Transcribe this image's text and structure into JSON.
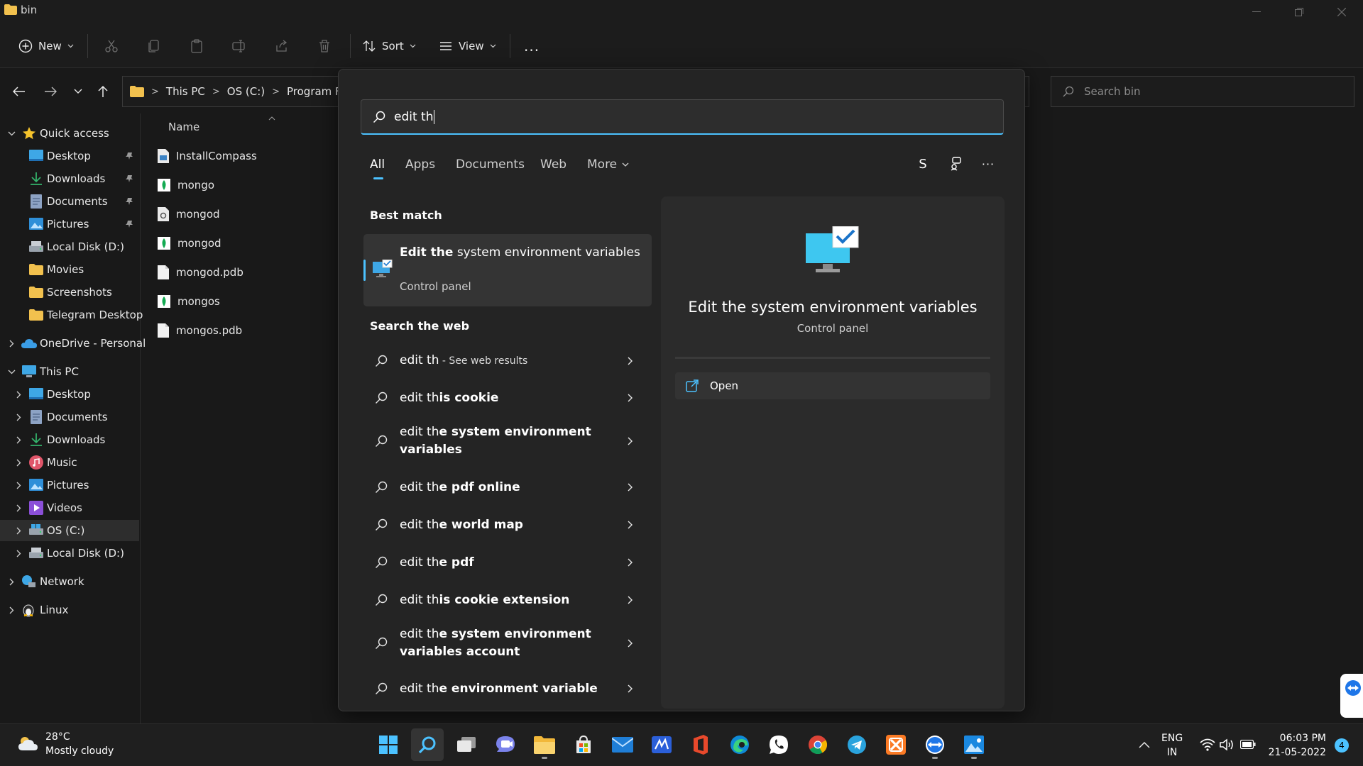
{
  "window": {
    "title": "bin",
    "toolbar": {
      "new_label": "New",
      "sort_label": "Sort",
      "view_label": "View",
      "more_label": "..."
    }
  },
  "address": {
    "crumbs": [
      "This PC",
      "OS (C:)",
      "Program Files"
    ],
    "search_placeholder": "Search bin"
  },
  "nav": {
    "quick_access": "Quick access",
    "quick_items": [
      "Desktop",
      "Downloads",
      "Documents",
      "Pictures",
      "Local Disk (D:)",
      "Movies",
      "Screenshots",
      "Telegram Desktop"
    ],
    "onedrive": "OneDrive - Personal",
    "this_pc": "This PC",
    "pc_items": [
      "Desktop",
      "Documents",
      "Downloads",
      "Music",
      "Pictures",
      "Videos",
      "OS (C:)",
      "Local Disk (D:)"
    ],
    "network": "Network",
    "linux": "Linux"
  },
  "files": {
    "column_name": "Name",
    "items": [
      "InstallCompass",
      "mongo",
      "mongod",
      "mongod",
      "mongod.pdb",
      "mongos",
      "mongos.pdb"
    ]
  },
  "search": {
    "query": "edit th",
    "tabs": [
      "All",
      "Apps",
      "Documents",
      "Web",
      "More"
    ],
    "profile_initial": "S",
    "more_dots": "···",
    "best_match_heading": "Best match",
    "best_match": {
      "title_bold": "Edit the",
      "title_rest": " system environment variables",
      "subtitle": "Control panel"
    },
    "web_heading": "Search the web",
    "web_first": {
      "bold": "edit th",
      "suffix": " - See web results"
    },
    "web_items": [
      {
        "typed": "edit th",
        "rest": "is cookie"
      },
      {
        "typed": "edit th",
        "rest": "e system environment variables"
      },
      {
        "typed": "edit th",
        "rest": "e pdf online"
      },
      {
        "typed": "edit th",
        "rest": "e world map"
      },
      {
        "typed": "edit th",
        "rest": "e pdf"
      },
      {
        "typed": "edit th",
        "rest": "is cookie extension"
      },
      {
        "typed": "edit th",
        "rest": "e system environment variables account"
      },
      {
        "typed": "edit th",
        "rest": "e environment variable"
      }
    ],
    "preview": {
      "title": "Edit the system environment variables",
      "subtitle": "Control panel",
      "open_label": "Open"
    }
  },
  "taskbar": {
    "weather_temp": "28°C",
    "weather_desc": "Mostly cloudy",
    "lang_line1": "ENG",
    "lang_line2": "IN",
    "time": "06:03 PM",
    "date": "21-05-2022",
    "notification_count": "4"
  },
  "colors": {
    "accent": "#4cc2ff",
    "folder": "#f2c14e"
  }
}
